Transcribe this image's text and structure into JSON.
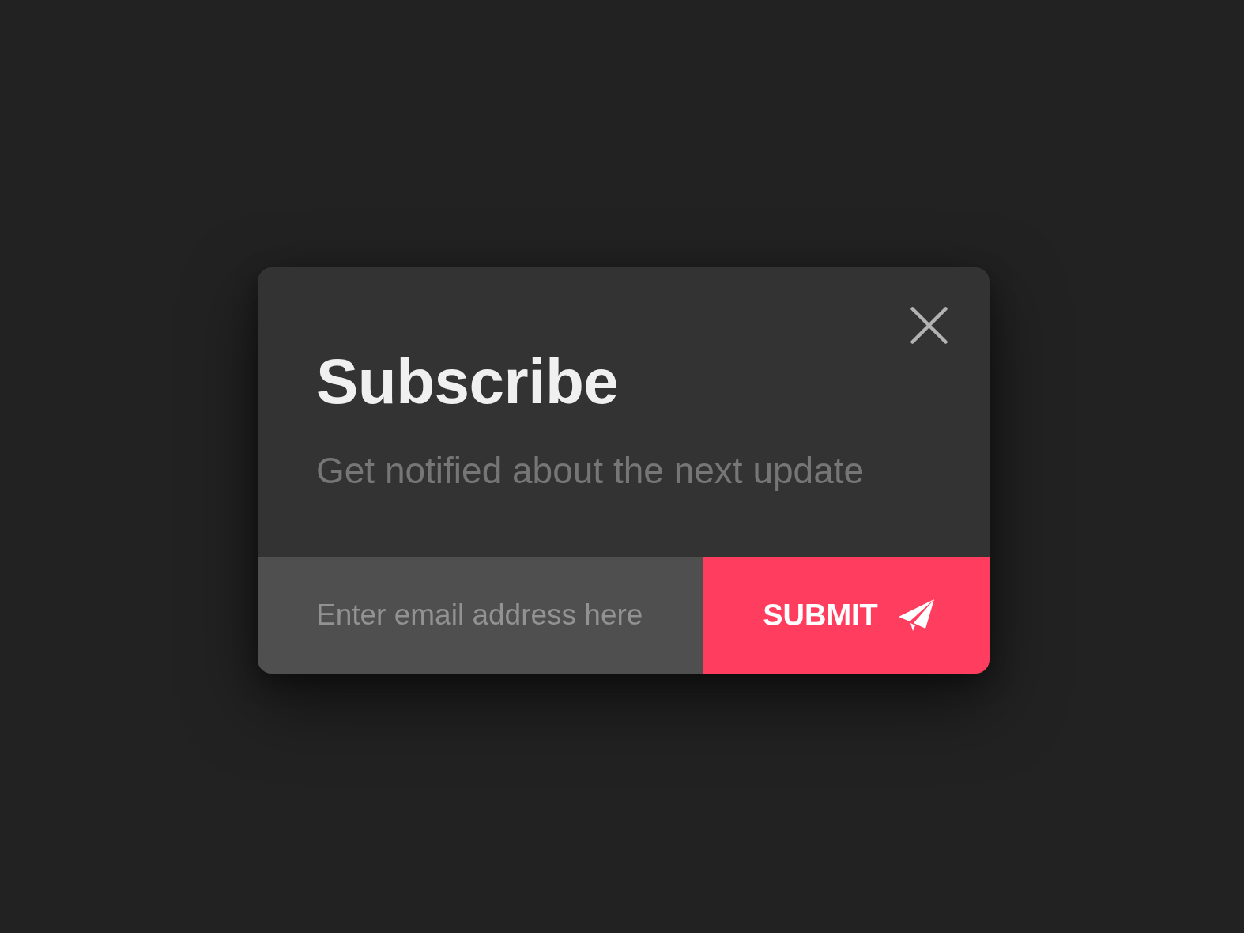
{
  "dialog": {
    "title": "Subscribe",
    "subtitle": "Get notified about the next update",
    "email_field": {
      "placeholder": "Enter email address here"
    },
    "submit_button": {
      "label": "SUBMIT"
    }
  }
}
